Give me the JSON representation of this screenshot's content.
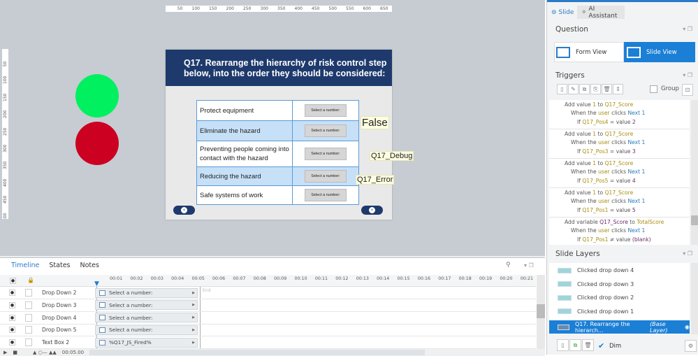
{
  "ruler": {
    "top": [
      "50",
      "100",
      "150",
      "200",
      "250",
      "300",
      "350",
      "400",
      "450",
      "500",
      "550",
      "600",
      "650",
      "700"
    ],
    "left": [
      "50",
      "100",
      "150",
      "200",
      "250",
      "300",
      "350",
      "400",
      "450",
      "500"
    ]
  },
  "canvas": {
    "circle_colors": [
      "#00f060",
      "#cc0020"
    ]
  },
  "slide": {
    "title": "Q17. Rearrange the hierarchy of risk control step below, into the order they should be considered:",
    "rows": [
      {
        "label": "Protect equipment",
        "select": "Select a number:"
      },
      {
        "label": "Eliminate the hazard",
        "select": "Select a number:"
      },
      {
        "label": "Preventing people coming into contact with the hazard",
        "select": "Select a number:"
      },
      {
        "label": "Reducing the hazard",
        "select": "Select a number:"
      },
      {
        "label": "Safe systems of work",
        "select": "Select a number:"
      }
    ],
    "var_false": "False",
    "var_debug": "Q17_Debug",
    "var_error": "Q17_Error",
    "prev": "‹",
    "next": "›",
    "accent": "#1e3a6d"
  },
  "right": {
    "tabs": [
      "Slide",
      "AI Assistant"
    ],
    "question_header": "Question",
    "form_view": "Form View",
    "slide_view": "Slide View",
    "triggers_header": "Triggers",
    "group_label": "Group",
    "triggers": [
      {
        "l1": [
          "Add value ",
          "1",
          " to ",
          "Q17_Score"
        ],
        "l2": [
          "When the ",
          "user",
          " clicks ",
          "Next 1"
        ],
        "l3": [
          "If ",
          "Q17_Pos4",
          " = value ",
          "2"
        ]
      },
      {
        "l1": [
          "Add value ",
          "1",
          " to ",
          "Q17_Score"
        ],
        "l2": [
          "When the ",
          "user",
          " clicks ",
          "Next 1"
        ],
        "l3": [
          "If ",
          "Q17_Pos3",
          " = value ",
          "3"
        ]
      },
      {
        "l1": [
          "Add value ",
          "1",
          " to ",
          "Q17_Score"
        ],
        "l2": [
          "When the ",
          "user",
          " clicks ",
          "Next 1"
        ],
        "l3": [
          "If ",
          "Q17_Pos5",
          " = value ",
          "4"
        ]
      },
      {
        "l1": [
          "Add value ",
          "1",
          " to ",
          "Q17_Score"
        ],
        "l2": [
          "When the ",
          "user",
          " clicks ",
          "Next 1"
        ],
        "l3": [
          "If ",
          "Q17_Pos1",
          " = value ",
          "5"
        ]
      },
      {
        "l1": [
          "Add variable ",
          "Q17_Score",
          " to ",
          "TotalScore"
        ],
        "l2": [
          "When the ",
          "user",
          " clicks ",
          "Next 1"
        ],
        "l3": [
          "If ",
          "Q17_Pos1",
          " ≠ value ",
          "(blank)"
        ]
      }
    ],
    "layers_header": "Slide Layers",
    "layers": [
      "Clicked drop down 4",
      "Clicked drop down 3",
      "Clicked drop down 2",
      "Clicked drop down 1"
    ],
    "base_layer": "Q17. Rearrange the hierarch...",
    "base_layer_tag": "(Base Layer)",
    "dim_label": "Dim",
    "dim_checked": true
  },
  "timeline": {
    "tabs": [
      "Timeline",
      "States",
      "Notes"
    ],
    "ticks": [
      "00:01",
      "00:02",
      "00:03",
      "00:04",
      "00:05",
      "00:06",
      "00:07",
      "00:08",
      "00:09",
      "00:10",
      "00:11",
      "00:12",
      "00:13",
      "00:14",
      "00:15",
      "00:16",
      "00:17",
      "00:18",
      "00:19",
      "00:20",
      "00:21"
    ],
    "end_label": "End",
    "rows": [
      {
        "name": "Drop Down 2",
        "bar": "Select a number:"
      },
      {
        "name": "Drop Down 3",
        "bar": "Select a number:"
      },
      {
        "name": "Drop Down 4",
        "bar": "Select a number:"
      },
      {
        "name": "Drop Down 5",
        "bar": "Select a number:"
      },
      {
        "name": "Text Box 2",
        "bar": "%Q17_JS_Fired%"
      }
    ],
    "time": "00:05.00"
  }
}
